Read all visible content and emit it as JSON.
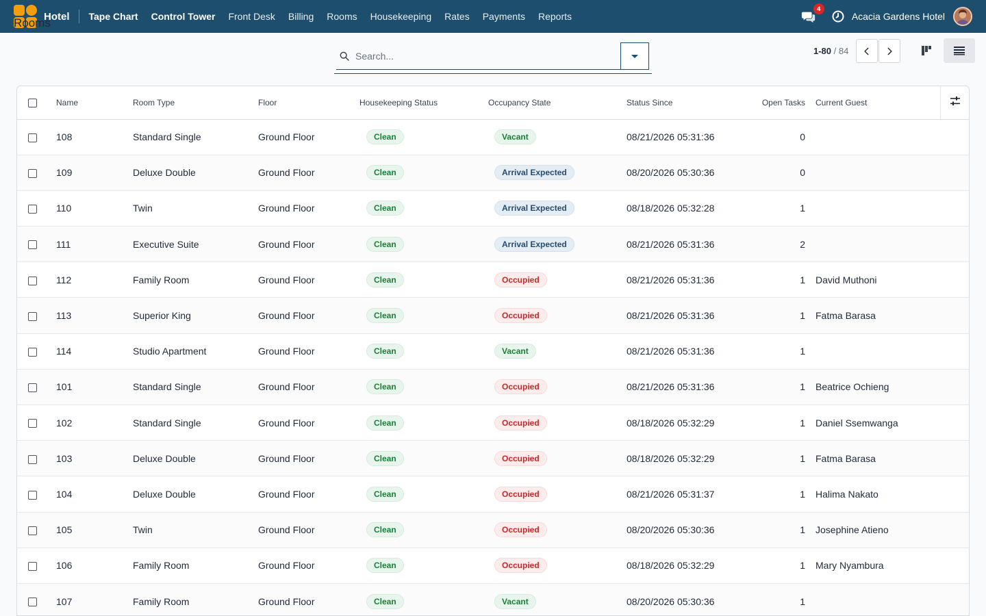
{
  "navbar": {
    "brand": "Hotel",
    "menu": [
      "Tape Chart",
      "Control Tower",
      "Front Desk",
      "Billing",
      "Rooms",
      "Housekeeping",
      "Rates",
      "Payments",
      "Reports"
    ],
    "notification_count": "4",
    "company": "Acacia Gardens Hotel",
    "accent": "#1d4e6e",
    "logo_color": "#f59e0b"
  },
  "control": {
    "breadcrumb": "Rooms",
    "search_placeholder": "Search...",
    "pager_range": "1-80",
    "pager_total": "84"
  },
  "table": {
    "columns": [
      "Name",
      "Room Type",
      "Floor",
      "Housekeeping Status",
      "Occupancy State",
      "Status Since",
      "Open Tasks",
      "Current Guest"
    ],
    "rows": [
      {
        "name": "108",
        "type": "Standard Single",
        "floor": "Ground Floor",
        "hk": "Clean",
        "occ": "Vacant",
        "since": "08/21/2026 05:31:36",
        "tasks": "0",
        "guest": ""
      },
      {
        "name": "109",
        "type": "Deluxe Double",
        "floor": "Ground Floor",
        "hk": "Clean",
        "occ": "Arrival Expected",
        "since": "08/20/2026 05:30:36",
        "tasks": "0",
        "guest": ""
      },
      {
        "name": "110",
        "type": "Twin",
        "floor": "Ground Floor",
        "hk": "Clean",
        "occ": "Arrival Expected",
        "since": "08/18/2026 05:32:28",
        "tasks": "1",
        "guest": ""
      },
      {
        "name": "111",
        "type": "Executive Suite",
        "floor": "Ground Floor",
        "hk": "Clean",
        "occ": "Arrival Expected",
        "since": "08/21/2026 05:31:36",
        "tasks": "2",
        "guest": ""
      },
      {
        "name": "112",
        "type": "Family Room",
        "floor": "Ground Floor",
        "hk": "Clean",
        "occ": "Occupied",
        "since": "08/21/2026 05:31:36",
        "tasks": "1",
        "guest": "David Muthoni"
      },
      {
        "name": "113",
        "type": "Superior King",
        "floor": "Ground Floor",
        "hk": "Clean",
        "occ": "Occupied",
        "since": "08/21/2026 05:31:36",
        "tasks": "1",
        "guest": "Fatma Barasa"
      },
      {
        "name": "114",
        "type": "Studio Apartment",
        "floor": "Ground Floor",
        "hk": "Clean",
        "occ": "Vacant",
        "since": "08/21/2026 05:31:36",
        "tasks": "1",
        "guest": ""
      },
      {
        "name": "101",
        "type": "Standard Single",
        "floor": "Ground Floor",
        "hk": "Clean",
        "occ": "Occupied",
        "since": "08/21/2026 05:31:36",
        "tasks": "1",
        "guest": "Beatrice Ochieng"
      },
      {
        "name": "102",
        "type": "Standard Single",
        "floor": "Ground Floor",
        "hk": "Clean",
        "occ": "Occupied",
        "since": "08/18/2026 05:32:29",
        "tasks": "1",
        "guest": "Daniel Ssemwanga"
      },
      {
        "name": "103",
        "type": "Deluxe Double",
        "floor": "Ground Floor",
        "hk": "Clean",
        "occ": "Occupied",
        "since": "08/18/2026 05:32:29",
        "tasks": "1",
        "guest": "Fatma Barasa"
      },
      {
        "name": "104",
        "type": "Deluxe Double",
        "floor": "Ground Floor",
        "hk": "Clean",
        "occ": "Occupied",
        "since": "08/21/2026 05:31:37",
        "tasks": "1",
        "guest": "Halima Nakato"
      },
      {
        "name": "105",
        "type": "Twin",
        "floor": "Ground Floor",
        "hk": "Clean",
        "occ": "Occupied",
        "since": "08/20/2026 05:30:36",
        "tasks": "1",
        "guest": "Josephine Atieno"
      },
      {
        "name": "106",
        "type": "Family Room",
        "floor": "Ground Floor",
        "hk": "Clean",
        "occ": "Occupied",
        "since": "08/18/2026 05:32:29",
        "tasks": "1",
        "guest": "Mary Nyambura"
      },
      {
        "name": "107",
        "type": "Family Room",
        "floor": "Ground Floor",
        "hk": "Clean",
        "occ": "Vacant",
        "since": "08/20/2026 05:30:36",
        "tasks": "1",
        "guest": ""
      }
    ]
  }
}
